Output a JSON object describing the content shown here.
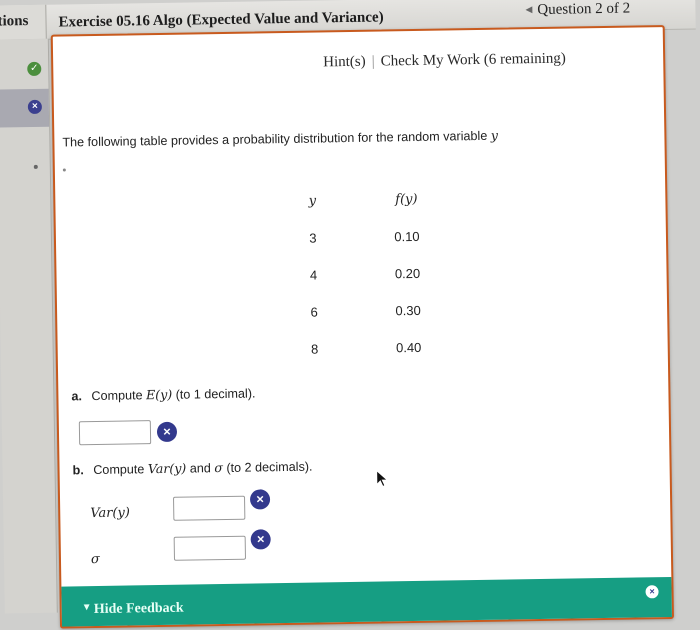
{
  "header": {
    "left_tab": "tions",
    "exercise_title": "Exercise 05.16 Algo (Expected Value and Variance)",
    "question_label": "Question 2 of 2"
  },
  "toolbar": {
    "hints": "Hint(s)",
    "separator": "|",
    "check_work": "Check My Work (6 remaining)"
  },
  "problem": {
    "intro": "The following table provides a probability distribution for the random variable",
    "variable": "y",
    "table": {
      "headers": [
        "y",
        "f(y)"
      ],
      "rows": [
        [
          "3",
          "0.10"
        ],
        [
          "4",
          "0.20"
        ],
        [
          "6",
          "0.30"
        ],
        [
          "8",
          "0.40"
        ]
      ]
    },
    "part_a": {
      "letter": "a.",
      "text_before": "Compute",
      "expr": "E(y)",
      "text_after": "(to 1 decimal).",
      "value": ""
    },
    "part_b": {
      "letter": "b.",
      "text_before": "Compute",
      "expr": "Var(y)",
      "text_mid": "and",
      "sigma": "σ",
      "text_after": "(to 2 decimals).",
      "var_label": "Var(y)",
      "var_value": "",
      "sigma_label": "σ",
      "sigma_value": ""
    }
  },
  "feedback": {
    "label": "Hide Feedback"
  },
  "colors": {
    "panel_border": "#c85a1e",
    "feedback_bar": "#169e83",
    "error_icon": "#33398d",
    "correct_icon": "#4c8f3e"
  },
  "icons": {
    "incorrect": "×",
    "correct": "✓",
    "prev_arrow": "◀",
    "caret": "▼"
  }
}
